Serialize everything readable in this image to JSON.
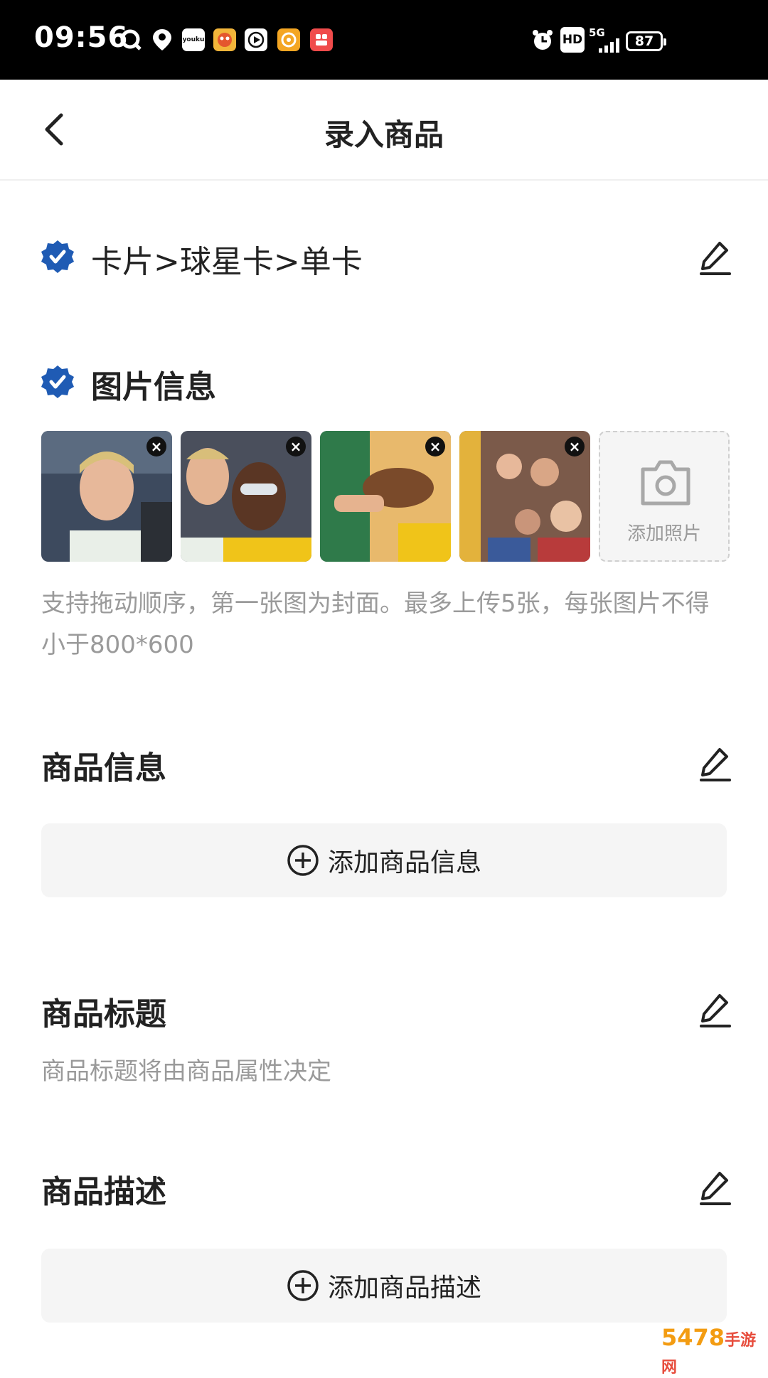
{
  "status_bar": {
    "time": "09:56",
    "app_icons": [
      "search-app-icon",
      "baidu-map-icon",
      "youku-icon",
      "game-app-icon",
      "video-player-icon",
      "orange-app-icon",
      "red-app-icon"
    ],
    "alarm_icon": "alarm-icon",
    "hd_label": "HD",
    "network_label": "5G",
    "battery_level": "87"
  },
  "nav": {
    "title": "录入商品",
    "back_icon": "chevron-left-icon"
  },
  "category": {
    "path": "卡片>球星卡>单卡"
  },
  "images": {
    "section_title": "图片信息",
    "thumbnails": [
      {
        "name": "photo-1",
        "remove": "×"
      },
      {
        "name": "photo-2",
        "remove": "×"
      },
      {
        "name": "photo-3",
        "remove": "×"
      },
      {
        "name": "photo-4",
        "remove": "×"
      }
    ],
    "add_photo_label": "添加照片",
    "hint": "支持拖动顺序，第一张图为封面。最多上传5张，每张图片不得小于800*600"
  },
  "product_info": {
    "section_title": "商品信息",
    "add_label": "添加商品信息"
  },
  "product_title": {
    "section_title": "商品标题",
    "placeholder": "商品标题将由商品属性决定"
  },
  "product_desc": {
    "section_title": "商品描述",
    "add_label": "添加商品描述"
  },
  "watermark": {
    "text": "5478",
    "sub": "手游网"
  },
  "colors": {
    "accent": "#1f5bb4",
    "hint_text": "#9a9a9a",
    "button_bg": "#f5f5f5"
  }
}
